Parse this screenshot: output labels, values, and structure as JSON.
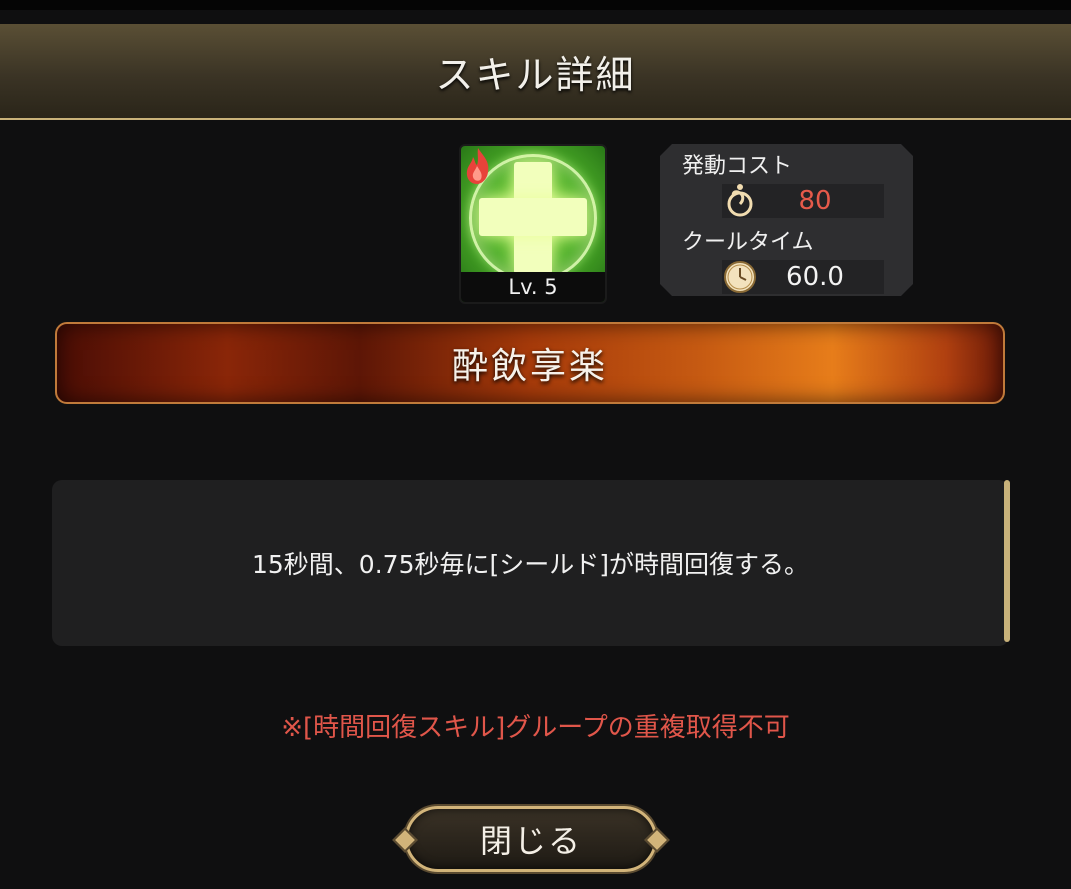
{
  "dialog": {
    "title": "スキル詳細"
  },
  "skill": {
    "level": "Lv. 5",
    "icon": "heal-cross-icon",
    "element_icon": "fire-icon",
    "name": "酔飲享楽",
    "cost_label": "発動コスト",
    "cost_value": "80",
    "cost_icon": "energy-orb-icon",
    "cooldown_label": "クールタイム",
    "cooldown_value": "60.0",
    "cooldown_icon": "clock-icon",
    "description": "15秒間、0.75秒毎に[シールド]が時間回復する。",
    "note": "※[時間回復スキル]グループの重複取得不可"
  },
  "buttons": {
    "close_label": "閉じる"
  },
  "colors": {
    "accent_gold": "#c9b27a",
    "cost_red": "#e65a4a",
    "note_red": "#e0564a"
  }
}
